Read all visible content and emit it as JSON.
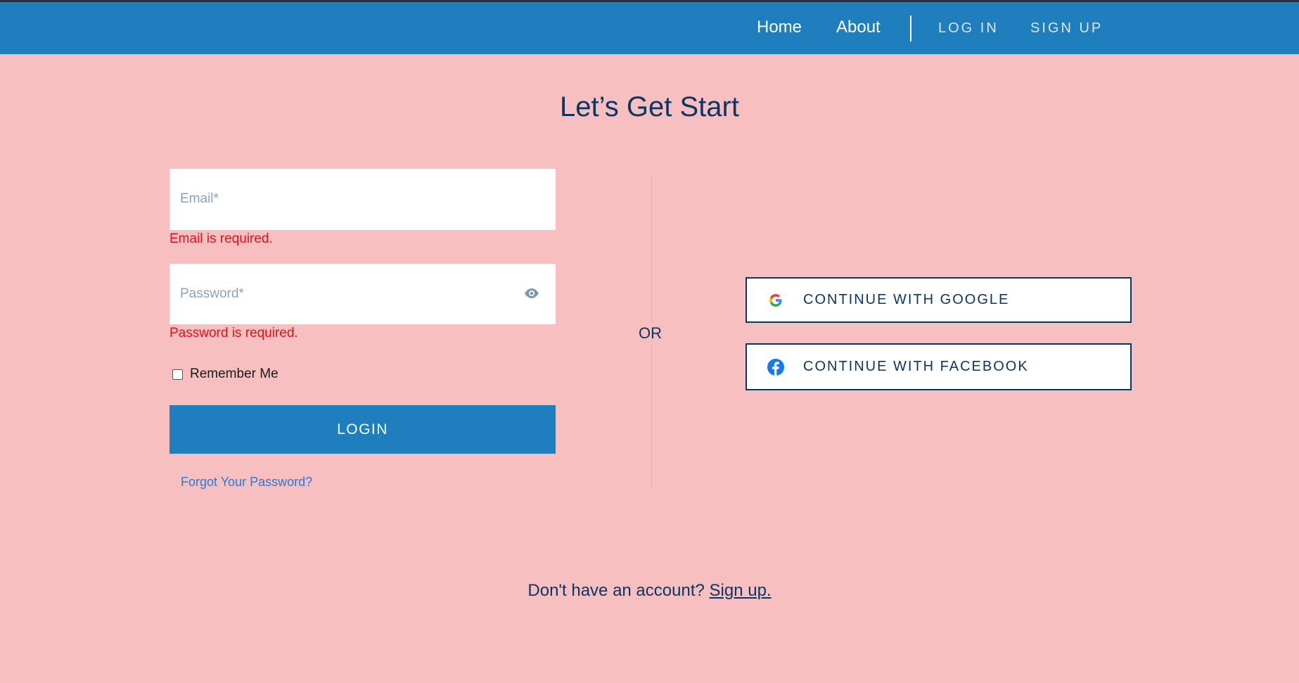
{
  "nav": {
    "home": "Home",
    "about": "About",
    "login": "LOG IN",
    "signup": "SIGN UP"
  },
  "heading": "Let’s Get Start",
  "form": {
    "email_placeholder": "Email*",
    "email_error": "Email is required.",
    "password_placeholder": "Password*",
    "password_error": "Password is required.",
    "remember_label": "Remember Me",
    "login_label": "LOGIN",
    "forgot_label": "Forgot Your Password?"
  },
  "divider": {
    "or_label": "OR"
  },
  "social": {
    "google_label": "CONTINUE WITH GOOGLE",
    "facebook_label": "CONTINUE WITH FACEBOOK"
  },
  "footer": {
    "prompt": "Don't have an account?",
    "signup_link": "Sign up."
  },
  "colors": {
    "background": "#f7bfbf",
    "nav": "#1f7fbe",
    "primary_text": "#0d3563",
    "error": "#e3121b",
    "link": "#2b7ad6"
  },
  "icons": {
    "password_toggle": "eye-icon",
    "google": "google-icon",
    "facebook": "facebook-icon"
  }
}
